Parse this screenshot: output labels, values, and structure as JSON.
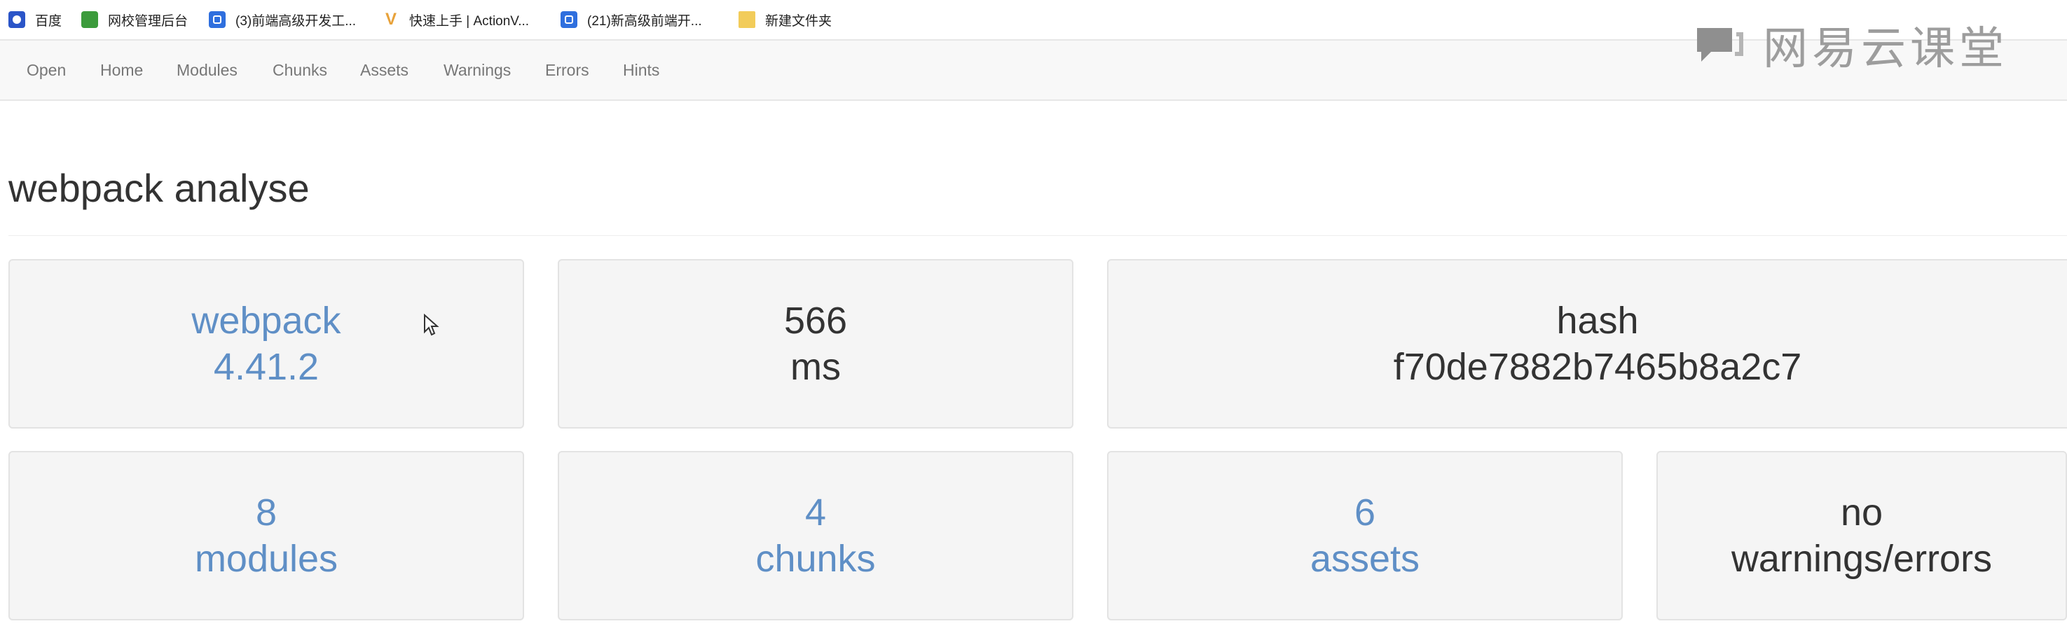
{
  "bookmarks": [
    {
      "label": "百度",
      "icon": "baidu-paw-icon"
    },
    {
      "label": "网校管理后台",
      "icon": "green-bookmark-icon"
    },
    {
      "label": "(3)前端高级开发工...",
      "icon": "blue-page-icon"
    },
    {
      "label": "快速上手 | ActionV...",
      "icon": "v-logo-icon"
    },
    {
      "label": "(21)新高级前端开...",
      "icon": "blue-page-icon"
    },
    {
      "label": "新建文件夹",
      "icon": "folder-icon"
    }
  ],
  "nav": [
    "Open",
    "Home",
    "Modules",
    "Chunks",
    "Assets",
    "Warnings",
    "Errors",
    "Hints"
  ],
  "watermark": {
    "text": "网易云课堂",
    "icon": "netease-cloud-classroom-icon"
  },
  "page_title": "webpack analyse",
  "stats": {
    "version": {
      "line1": "webpack",
      "line2": "4.41.2"
    },
    "time": {
      "line1": "566",
      "line2": "ms"
    },
    "hash": {
      "line1": "hash",
      "line2": "f70de7882b7465b8a2c7"
    },
    "modules": {
      "line1": "8",
      "line2": "modules"
    },
    "chunks": {
      "line1": "4",
      "line2": "chunks"
    },
    "assets": {
      "line1": "6",
      "line2": "assets"
    },
    "warnings": {
      "line1": "no",
      "line2": "warnings/errors"
    }
  },
  "colors": {
    "link": "#5f8fc6",
    "card_bg": "#f5f5f5",
    "nav_bg": "#f8f8f8"
  }
}
